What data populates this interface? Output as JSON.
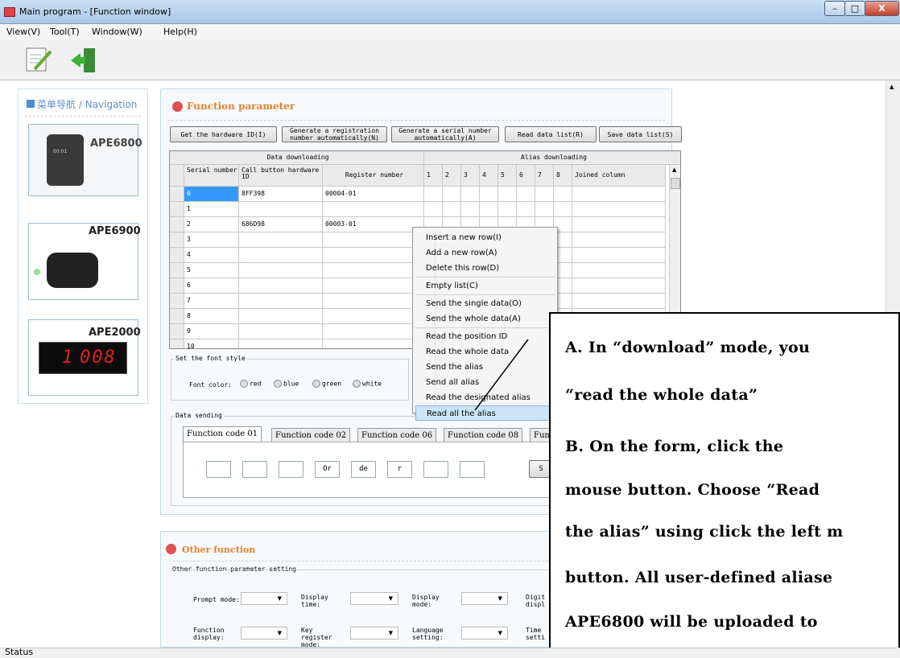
{
  "window": {
    "title": "Main program - [Function window]",
    "minimize": "–",
    "maximize": "□",
    "close": "X"
  },
  "menu": [
    "View(V)",
    "Tool(T)",
    "Window(W)",
    "Help(H)"
  ],
  "status": "Status",
  "nav": {
    "title_cn": "菜单导航",
    "title_en": "Navigation",
    "devices": [
      "APE6800",
      "APE6900",
      "APE2000"
    ],
    "watch_time": "00:01",
    "pager_digits": "008",
    "pager_prefix": "1"
  },
  "function_panel": {
    "title": "Function parameter",
    "buttons": [
      "Get the hardware ID(I)",
      "Generate a registration number automatically(N)",
      "Generate a serial number automatically(A)",
      "Read data list(R)",
      "Save data list(S)"
    ],
    "group_headers": [
      "Data downloading",
      "Alias downloading"
    ],
    "columns": [
      "Serial number",
      "Call button hardware ID",
      "Register number",
      "1",
      "2",
      "3",
      "4",
      "5",
      "6",
      "7",
      "8",
      "Joined column"
    ],
    "rows": [
      [
        "0",
        "8FF398",
        "00004-01"
      ],
      [
        "1",
        "",
        ""
      ],
      [
        "2",
        "686D98",
        "00003-01"
      ],
      [
        "3",
        "",
        ""
      ],
      [
        "4",
        "",
        ""
      ],
      [
        "5",
        "",
        ""
      ],
      [
        "6",
        "",
        ""
      ],
      [
        "7",
        "",
        ""
      ],
      [
        "8",
        "",
        ""
      ],
      [
        "9",
        "",
        ""
      ],
      [
        "10",
        "",
        ""
      ]
    ]
  },
  "context_menu": {
    "groups": [
      [
        "Insert a new row(I)",
        "Add a new row(A)",
        "Delete this row(D)"
      ],
      [
        "Empty list(C)"
      ],
      [
        "Send the single data(O)",
        "Send the whole data(A)"
      ],
      [
        "Read the position ID",
        "Read the whole data",
        "Send the alias",
        "Send all alias",
        "Read the designated alias",
        "Read all the alias"
      ]
    ],
    "highlighted": "Read all the alias"
  },
  "font_style": {
    "legend": "Set the font style",
    "label": "Font color:",
    "options": [
      "red",
      "blue",
      "green",
      "white"
    ]
  },
  "data_sending": {
    "legend": "Data sending",
    "tabs": [
      "Function code 01",
      "Function code 02",
      "Function code 06",
      "Function code 08",
      "Fun"
    ],
    "fields": [
      "",
      "",
      "",
      "Or",
      "de",
      "r",
      "",
      ""
    ],
    "send_btn": "S"
  },
  "other_panel": {
    "title": "Other function",
    "legend": "Other function parameter setting",
    "labels": [
      "Prompt mode:",
      "Display time:",
      "Display mode:",
      "Digit displ",
      "Function display:",
      "Key register mode:",
      "Language setting:",
      "Time setti"
    ]
  },
  "annotation": {
    "lines": [
      "A.  In  “download”  mode,  you",
      "“read the whole data”",
      "B.  On  the  form,  click  the",
      "mouse  button.  Choose  “Read",
      "the alias” using click the left m",
      "button. All user-defined aliase",
      "APE6800  will  be  uploaded  to"
    ]
  },
  "colors": {
    "accent": "#e2812b",
    "nav_title": "#5e8fc7",
    "highlight": "#cde4f7",
    "led": "#e12020"
  }
}
